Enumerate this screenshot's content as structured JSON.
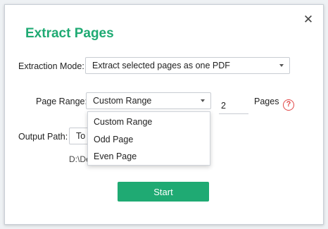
{
  "dialog": {
    "title": "Extract Pages",
    "close_glyph": "✕"
  },
  "extraction_mode": {
    "label": "Extraction Mode:",
    "value": "Extract selected pages as one PDF"
  },
  "page_range": {
    "label": "Page Range:",
    "value": "Custom Range",
    "pages_value": "2",
    "pages_label": "Pages",
    "help_glyph": "?",
    "options": [
      "Custom Range",
      "Odd Page",
      "Even Page"
    ]
  },
  "output_path": {
    "label": "Output Path:",
    "value": "To",
    "path_prefix": "D:\\De"
  },
  "start_button": {
    "label": "Start"
  },
  "colors": {
    "accent": "#1faa73",
    "help": "#e14646"
  }
}
